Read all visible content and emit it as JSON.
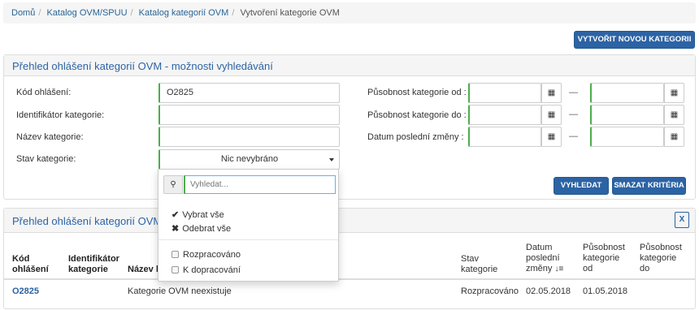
{
  "breadcrumb": {
    "items": [
      "Domů",
      "Katalog OVM/SPUU",
      "Katalog kategorií OVM"
    ],
    "active": "Vytvoření kategorie OVM",
    "separator": "/"
  },
  "actions": {
    "new_category": "VYTVOŘIT NOVOU KATEGORII"
  },
  "search_panel": {
    "title": "Přehled ohlášení kategorií OVM - možnosti vyhledávání",
    "labels": {
      "report_code": "Kód ohlášení:",
      "category_id": "Identifikátor kategorie:",
      "category_name": "Název kategorie:",
      "category_state": "Stav kategorie:",
      "validity_from": "Působnost kategorie od :",
      "validity_to": "Působnost kategorie do :",
      "last_change": "Datum poslední změny :"
    },
    "values": {
      "report_code": "O2825",
      "category_id": "",
      "category_name": "",
      "category_state": "Nic nevybráno"
    },
    "range_separator": "—",
    "search_button": "VYHLEDAT",
    "clear_button": "SMAZAT KRITÉRIA"
  },
  "results_panel": {
    "title": "Přehled ohlášení kategorií OVM",
    "export_icon": "excel-export-icon",
    "columns": {
      "code": [
        "Kód",
        "ohlášení"
      ],
      "identifier": [
        "Identifikátor",
        "kategorie"
      ],
      "name": "Název k",
      "state": [
        "Stav",
        "kategorie"
      ],
      "last_change": [
        "Datum",
        "poslední",
        "změny"
      ],
      "from": [
        "Působnost",
        "kategorie",
        "od"
      ],
      "to": [
        "Působnost",
        "kategorie",
        "do"
      ]
    },
    "rows": [
      {
        "code": "O2825",
        "identifier": "",
        "name": "Kategorie OVM neexistuje",
        "state": "Rozpracováno",
        "last_change": "02.05.2018",
        "from": "01.05.2018",
        "to": ""
      }
    ]
  },
  "dropdown": {
    "search_placeholder": "Vyhledat...",
    "select_all": "Vybrat vše",
    "deselect_all": "Odebrat vše",
    "options": [
      "Rozpracováno",
      "K dopracování"
    ]
  },
  "colors": {
    "accent": "#2c63a4",
    "valid_border": "#4cae4c"
  }
}
